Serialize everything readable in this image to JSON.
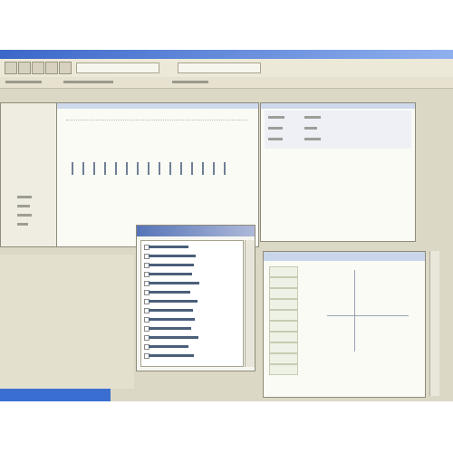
{
  "screen": {
    "menus": [
      "",
      "",
      "",
      "",
      ""
    ],
    "tree_items": [
      "",
      "",
      "",
      "",
      "",
      "",
      "",
      "",
      "",
      "",
      "",
      "",
      "",
      ""
    ],
    "grid_rows": [
      "",
      "",
      "",
      "",
      "",
      "",
      "",
      "",
      "",
      ""
    ]
  },
  "colors": {
    "titlebar": "#3b67c9",
    "panel_bg": "#fbfbf6",
    "window_chrome": "#dcd8c6",
    "taskbar_start": "#3a6fd1"
  },
  "icons": {
    "toolbar": [
      "new-icon",
      "open-icon",
      "save-icon",
      "print-icon",
      "help-icon"
    ]
  }
}
